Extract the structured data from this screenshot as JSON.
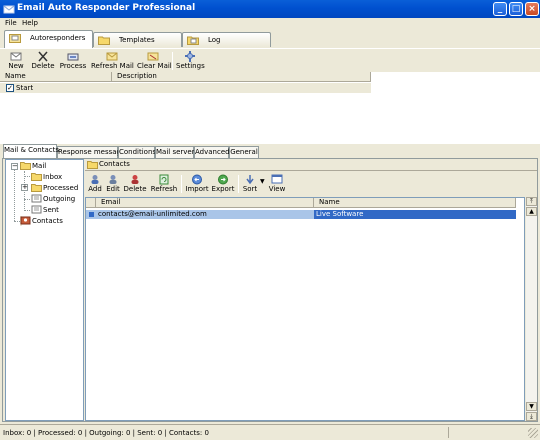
{
  "window": {
    "title": "Email Auto Responder Professional"
  },
  "menu": [
    "File",
    "Help"
  ],
  "top_tabs": [
    {
      "label": "Autoresponders",
      "icon": "envelope-folder-icon",
      "active": true
    },
    {
      "label": "Templates",
      "icon": "folder-icon",
      "active": false
    },
    {
      "label": "Log",
      "icon": "log-icon",
      "active": false
    }
  ],
  "toolbar": [
    {
      "label": "New",
      "icon": "new-icon"
    },
    {
      "label": "Delete",
      "icon": "delete-x-icon"
    },
    {
      "label": "Process",
      "icon": "process-icon"
    },
    {
      "label": "Refresh Mail",
      "icon": "refresh-mail-icon"
    },
    {
      "label": "Clear Mail",
      "icon": "clear-mail-icon"
    },
    {
      "label": "Settings",
      "icon": "settings-icon"
    }
  ],
  "responders_table": {
    "columns": [
      "Name",
      "Description"
    ],
    "rows": [
      {
        "name": "Start",
        "checked": true,
        "description": ""
      }
    ]
  },
  "bottom_tabs": [
    {
      "label": "Mail & Contacts",
      "active": true
    },
    {
      "label": "Response message",
      "active": false
    },
    {
      "label": "Conditions",
      "active": false
    },
    {
      "label": "Mail server",
      "active": false
    },
    {
      "label": "Advanced",
      "active": false
    },
    {
      "label": "General",
      "active": false
    }
  ],
  "tree": {
    "root": "Mail",
    "children": [
      "Inbox",
      "Processed",
      "Outgoing",
      "Sent"
    ],
    "contacts": "Contacts"
  },
  "contacts_panel": {
    "title": "Contacts",
    "toolbar": [
      {
        "label": "Add",
        "icon": "add-contact-icon"
      },
      {
        "label": "Edit",
        "icon": "edit-contact-icon"
      },
      {
        "label": "Delete",
        "icon": "delete-contact-icon"
      },
      {
        "label": "Refresh",
        "icon": "refresh-icon"
      },
      {
        "label": "Import",
        "icon": "import-icon"
      },
      {
        "label": "Export",
        "icon": "export-icon"
      },
      {
        "label": "Sort",
        "icon": "sort-icon"
      },
      {
        "label": "View",
        "icon": "view-icon"
      }
    ],
    "columns": [
      "Email",
      "Name"
    ],
    "rows": [
      {
        "email": "contacts@email-unlimited.com",
        "name": "Live Software"
      }
    ]
  },
  "status": "Inbox: 0   |   Processed: 0   |   Outgoing: 0   |   Sent: 0   |   Contacts: 0"
}
